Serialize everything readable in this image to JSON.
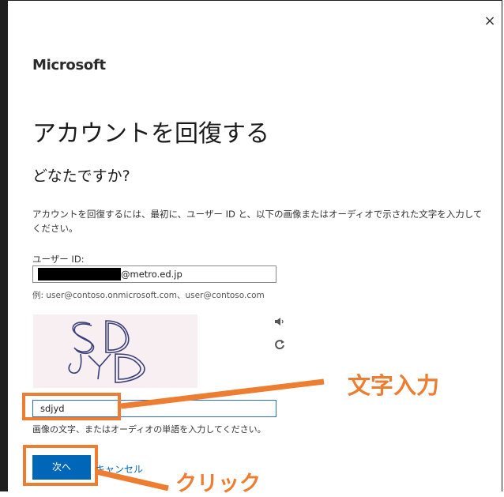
{
  "dialog": {
    "close_glyph": "×",
    "brand": "Microsoft",
    "title": "アカウントを回復する",
    "subtitle": "どなたですか?",
    "description": "アカウントを回復するには、最初に、ユーザー ID と、以下の画像またはオーディオで示された文字を入力してください。"
  },
  "user_id": {
    "label": "ユーザー ID:",
    "value_suffix": "@metro.ed.jp",
    "example": "例: user@contoso.onmicrosoft.com、user@contoso.com"
  },
  "captcha": {
    "image_text": "SDJYD",
    "audio_icon": "speaker-icon",
    "refresh_icon": "refresh-icon",
    "input_value": "sdjyd",
    "hint": "画像の文字、またはオーディオの単語を入力してください。"
  },
  "actions": {
    "next_label": "次へ",
    "cancel_label": "キャンセル"
  },
  "annotations": {
    "input_callout": "文字入力",
    "click_callout": "クリック",
    "accent_color": "#ed7d31"
  },
  "colors": {
    "primary": "#0067b8",
    "captcha_bg": "#f7eff2"
  }
}
